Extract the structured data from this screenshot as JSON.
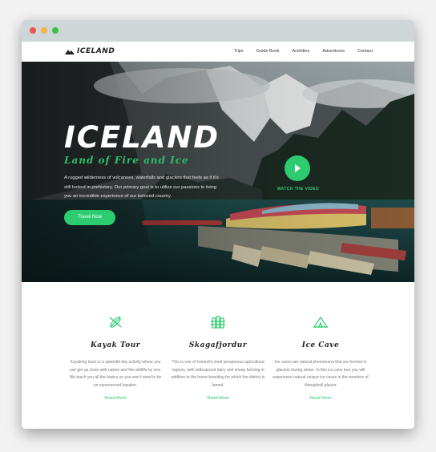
{
  "nav": {
    "logo_text": "ICELAND",
    "items": [
      "Trips",
      "Guide Book",
      "Activities",
      "Adventures",
      "Contact"
    ]
  },
  "hero": {
    "title": "ICELAND",
    "subtitle": "Land of Fire and Ice",
    "description": "A rugged wilderness of volcanoes, waterfalls and glaciers that feels as if it's still locked in prehistory. Our primary goal is to utilize our passions to bring you an incredible experience of our beloved country.",
    "cta_label": "Travel Now",
    "watch_label": "WATCH THE VIDEO"
  },
  "features": [
    {
      "icon": "kayak-icon",
      "title": "Kayak Tour",
      "text": "Kayaking tours is a splendid day activity where you can get up close with nature and the wildlife by sea. We teach you all the basics so you won't need to be an experienced kayaker.",
      "link": "Read More"
    },
    {
      "icon": "fence-icon",
      "title": "Skagafjordur",
      "text": "This is one of Iceland's most prosperous agricultural regions, with widespread dairy and sheep farming in addition to the horse breeding for which the district is famed.",
      "link": "Read More"
    },
    {
      "icon": "tent-icon",
      "title": "Ice Cave",
      "text": "Ice caves are natural phenomena that are formed in glaciers during winter. In this ice cave tour you will experience natural unique ice caves in the wonders of Vatnajokull glacier.",
      "link": "Read More"
    }
  ],
  "colors": {
    "accent": "#2ecc71",
    "titlebar": "#cfd6d8"
  }
}
